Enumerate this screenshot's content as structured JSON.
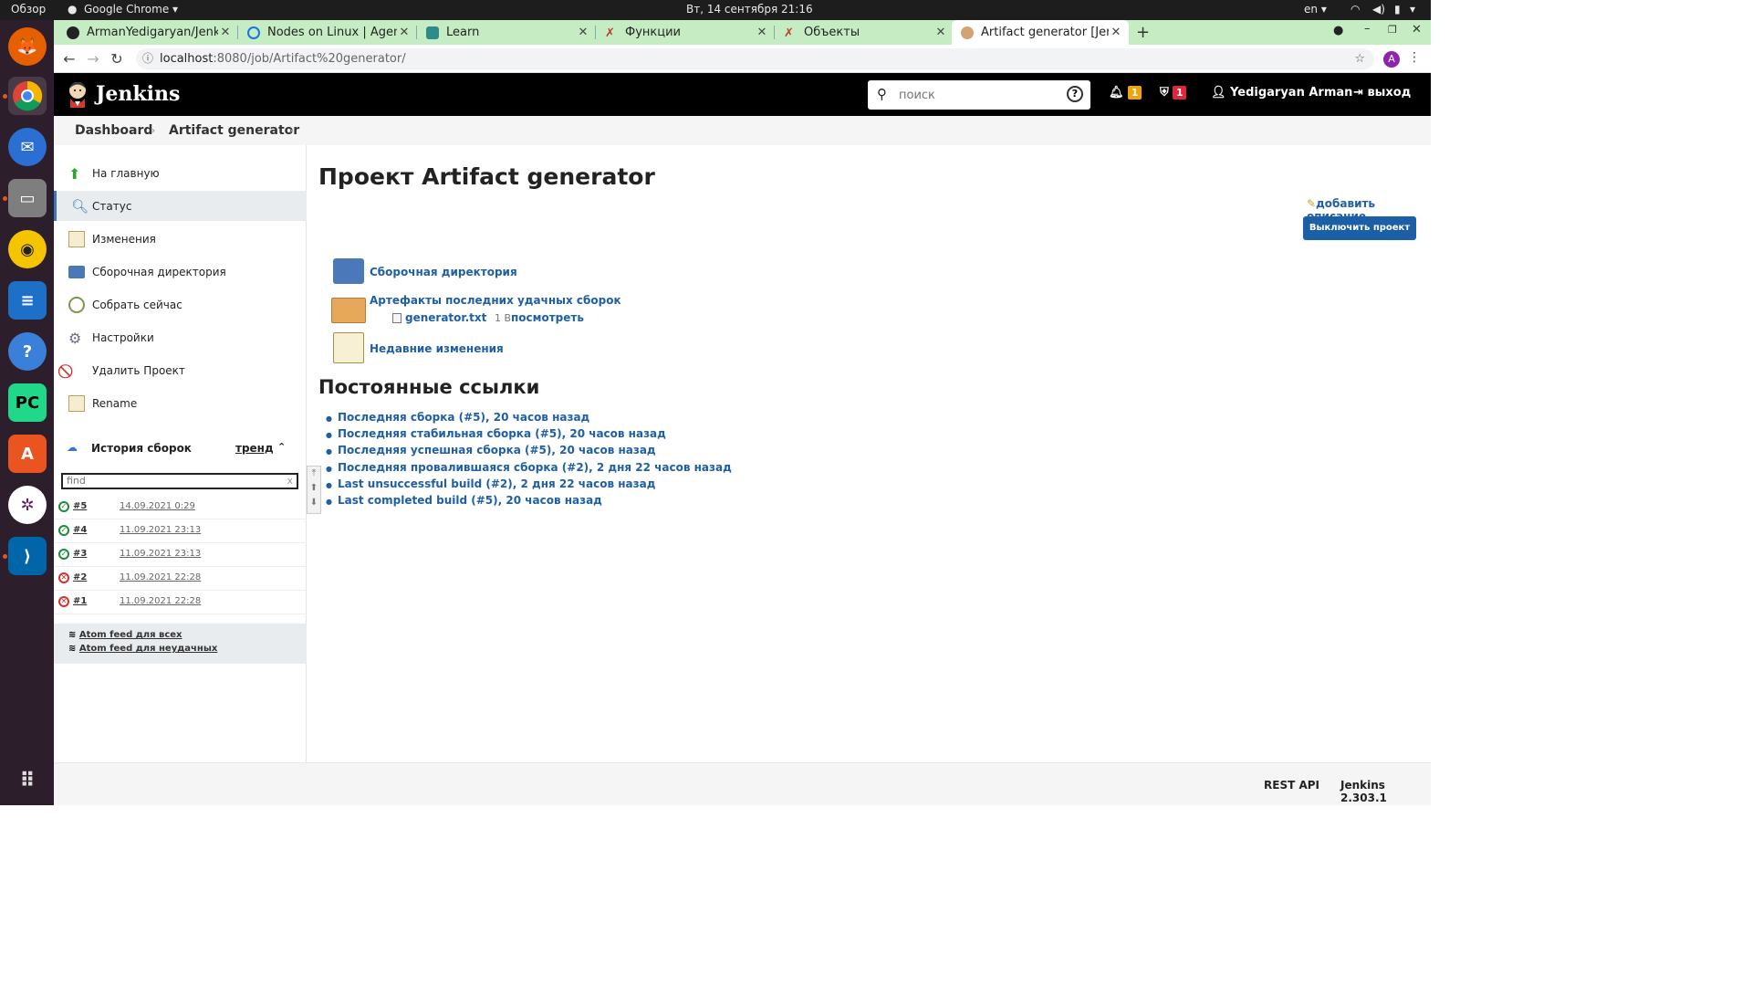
{
  "os": {
    "activities": "Обзор",
    "app_menu": "Google Chrome",
    "clock": "Вт, 14 сентября  21:16",
    "lang": "en"
  },
  "tabs": [
    {
      "label": "ArmanYedigaryan/Jenkin",
      "color": "#222"
    },
    {
      "label": "Nodes on Linux | Agents (",
      "color": "#1a73e8"
    },
    {
      "label": "Learn",
      "color": "#2e8b8b"
    },
    {
      "label": "Функции",
      "color": "#c0392b"
    },
    {
      "label": "Объекты",
      "color": "#c0392b"
    },
    {
      "label": "Artifact generator [Jenkin",
      "color": "#d4a373"
    }
  ],
  "address": {
    "host": "localhost",
    "rest": ":8080/job/Artifact%20generator/",
    "avatar": "A"
  },
  "header": {
    "brand": "Jenkins",
    "search_placeholder": "поиск",
    "notif_count": "1",
    "security_count": "1",
    "user": "Yedigaryan Arman",
    "logout": "выход"
  },
  "breadcrumbs": [
    "Dashboard",
    "Artifact generator"
  ],
  "sidebar": {
    "items": [
      "На главную",
      "Статус",
      "Изменения",
      "Сборочная директория",
      "Собрать сейчас",
      "Настройки",
      "Удалить Проект",
      "Rename"
    ]
  },
  "history": {
    "title": "История сборок",
    "trend": "тренд",
    "find_placeholder": "find",
    "clear": "x",
    "builds": [
      {
        "num": "#5",
        "date": "14.09.2021 0:29",
        "status": "success"
      },
      {
        "num": "#4",
        "date": "11.09.2021 23:13",
        "status": "success"
      },
      {
        "num": "#3",
        "date": "11.09.2021 23:13",
        "status": "success"
      },
      {
        "num": "#2",
        "date": "11.09.2021 22:28",
        "status": "failed"
      },
      {
        "num": "#1",
        "date": "11.09.2021 22:28",
        "status": "failed"
      }
    ],
    "feeds": [
      "Atom feed для всех",
      "Atom feed для неудачных"
    ]
  },
  "main": {
    "title": "Проект Artifact generator",
    "add_description": "добавить описание",
    "disable_button": "Выключить проект",
    "workspace_link": "Сборочная директория",
    "artifacts_link": "Артефакты последних удачных сборок",
    "artifact_file": "generator.txt",
    "artifact_size": "1 B",
    "artifact_view": "посмотреть",
    "recent_changes": "Недавние изменения",
    "permalinks_title": "Постоянные ссылки",
    "permalinks": [
      "Последняя сборка (#5), 20 часов назад",
      "Последняя стабильная сборка (#5), 20 часов назад",
      "Последняя успешная сборка (#5), 20 часов назад",
      "Последняя провалившаяся сборка (#2), 2 дня 22 часов назад",
      "Last unsuccessful build (#2), 2 дня 22 часов назад",
      "Last completed build (#5), 20 часов назад"
    ]
  },
  "footer": {
    "rest_api": "REST API",
    "version": "Jenkins 2.303.1"
  },
  "colors": {
    "link": "#1f5fa6",
    "button": "#1b5fa6",
    "badge_orange": "#f0a30a",
    "badge_red": "#e2263a",
    "tabbar": "#c6ecc3",
    "dock": "#2c1e2a"
  }
}
